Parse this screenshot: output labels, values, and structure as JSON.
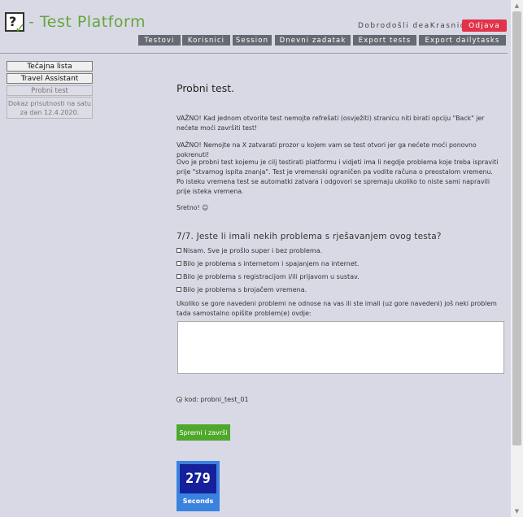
{
  "header": {
    "brand": "- Test Platform",
    "welcome": "Dobrodošli deaKrasnic",
    "logout_label": "Odjava"
  },
  "nav": [
    "Testovi",
    "Korisnici",
    "Session",
    "Dnevni zadatak",
    "Export tests",
    "Export dailytasks"
  ],
  "sidebar": {
    "items": [
      "Tečajna lista",
      "Travel Assistant"
    ],
    "current": "Probni test",
    "note_line1": "Dokaz prisutnosti na satu",
    "note_line2": "za dan 12.4.2020."
  },
  "main": {
    "title": "Probni test.",
    "paragraphs": [
      "VAŽNO! Kad jednom otvorite test nemojte refrešati (osvježiti) stranicu niti birati opciju \"Back\" jer nećete moći završiti test!",
      "VAŽNO! Nemojte na X zatvarati prozor u kojem vam se test otvori jer ga nećete moći ponovno pokrenuti!",
      "Ovo je probni test kojemu je cilj testirati platformu i vidjeti ima li negdje problema koje treba ispraviti prije \"stvarnog ispita znanja\". Test je vremenski ograničen pa vodite računa o preostalom vremenu. Po isteku vremena test se automatki zatvara i odgovori se spremaju ukoliko to niste sami napravili prije isteka vremena.",
      "Sretno! ☺"
    ],
    "question": "7/7. Jeste li imali nekih problema s rješavanjem ovog testa?",
    "options": [
      "Nisam. Sve je prošlo super i bez problema.",
      "Bilo je problema s internetom i spajanjem na internet.",
      "Bilo je problema s registracijom i/ili prijavom u sustav.",
      "Bilo je problema s brojačem vremena."
    ],
    "other_prompt": "Ukoliko se gore navedeni problemi ne odnose na vas ili ste imali (uz gore navedeni) još neki problem tada samostalno opišite problem(e) ovdje:",
    "textarea_value": "",
    "code_label": "kod: probni_test_01",
    "save_label": "Spremi i završi"
  },
  "timer": {
    "value": "279",
    "unit": "Seconds"
  }
}
